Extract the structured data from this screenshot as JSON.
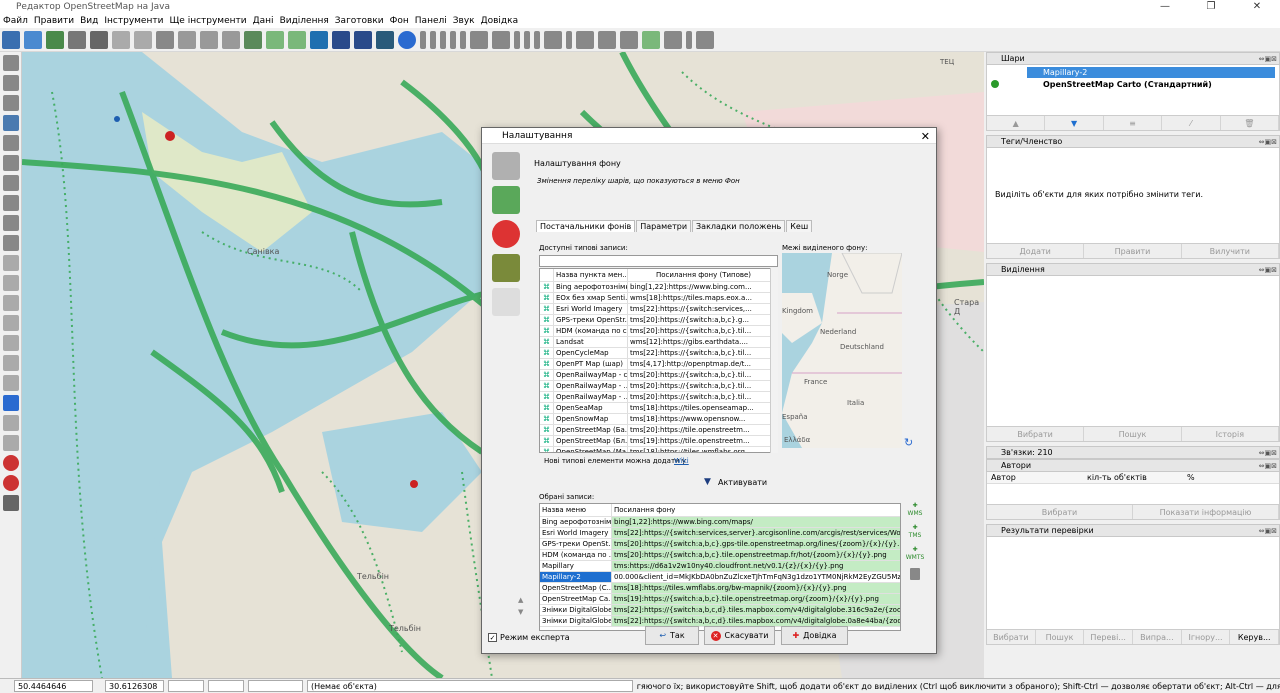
{
  "window": {
    "title": "Редактор OpenStreetMap на Java",
    "controls": [
      "—",
      "❐",
      "✕"
    ]
  },
  "menu": [
    "Файл",
    "Правити",
    "Вид",
    "Інструменти",
    "Ще інструменти",
    "Дані",
    "Виділення",
    "Заготовки",
    "Фон",
    "Панелі",
    "Звук",
    "Довідка"
  ],
  "dialog": {
    "title": "Налаштування",
    "header": "Налаштування фону",
    "subheader": "Змінення переліку шарів, що показуються в меню Фон",
    "tabs": [
      "Постачальники фонів",
      "Параметри",
      "Закладки положень",
      "Кеш"
    ],
    "available_label": "Доступні типові записи:",
    "bounds_label": "Межі виділеного фону:",
    "available_columns": [
      "Назва пункта мен...",
      "Посилання фону (Типове)"
    ],
    "available_rows": [
      {
        "name": "Bing аерофотознімки",
        "url": "bing[1,22]:https://www.bing.com..."
      },
      {
        "name": "EOx без хмар Senti...",
        "url": "wms[18]:https://tiles.maps.eox.a..."
      },
      {
        "name": "Esri World Imagery",
        "url": "tms[22]:https://{switch:services,..."
      },
      {
        "name": "GPS-треки OpenStr...",
        "url": "tms[20]:https://{switch:a,b,c}.g..."
      },
      {
        "name": "HDM (команда по с...",
        "url": "tms[20]:https://{switch:a,b,c}.til..."
      },
      {
        "name": "Landsat",
        "url": "wms[12]:https://gibs.earthdata...."
      },
      {
        "name": "OpenCycleMap",
        "url": "tms[22]:https://{switch:a,b,c}.til..."
      },
      {
        "name": "OpenPT Map (шар)",
        "url": "tms[4,17]:http://openptmap.de/t..."
      },
      {
        "name": "OpenRailwayMap - с...",
        "url": "tms[20]:https://{switch:a,b,c}.til..."
      },
      {
        "name": "OpenRailwayMap - ...",
        "url": "tms[20]:https://{switch:a,b,c}.til..."
      },
      {
        "name": "OpenRailwayMap - ...",
        "url": "tms[20]:https://{switch:a,b,c}.til..."
      },
      {
        "name": "OpenSeaMap",
        "url": "tms[18]:https://tiles.openseamap..."
      },
      {
        "name": "OpenSnowMap",
        "url": "tms[18]:https://www.opensnow..."
      },
      {
        "name": "OpenStreetMap (Ба...",
        "url": "tms[20]:https://tile.openstreetm..."
      },
      {
        "name": "OpenStreetMap (Бл...",
        "url": "tms[19]:https://tile.openstreetm..."
      },
      {
        "name": "OpenStreetMap (Ma...",
        "url": "tms[18]:https://tiles.wmflabs.org..."
      }
    ],
    "map_labels": [
      "Norge",
      "Kingdom",
      "Nederland",
      "Deutschland",
      "France",
      "Italia",
      "España",
      "Ελλάδα"
    ],
    "hint_text": "Нові типові елементи можна додати у",
    "hint_link": "Wiki",
    "activate_label": "Активувати",
    "selected_label": "Обрані записи:",
    "selected_columns": [
      "Назва меню",
      "Посилання фону"
    ],
    "selected_rows": [
      {
        "name": "Bing аерофотознімки",
        "url": "bing[1,22]:https://www.bing.com/maps/"
      },
      {
        "name": "Esri World Imagery",
        "url": "tms[22]:https://{switch:services,server}.arcgisonline.com/arcgis/rest/services/Wo..."
      },
      {
        "name": "GPS-треки OpenSt...",
        "url": "tms[20]:https://{switch:a,b,c}.gps-tile.openstreetmap.org/lines/{zoom}/{x}/{y}.png"
      },
      {
        "name": "HDM (команда по ...",
        "url": "tms[20]:https://{switch:a,b,c}.tile.openstreetmap.fr/hot/{zoom}/{x}/{y}.png"
      },
      {
        "name": "Mapillary",
        "url": "tms:https://d6a1v2w10ny40.cloudfront.net/v0.1/{z}/{x}/{y}.png"
      },
      {
        "name": "Mapillary-2",
        "url": "00.000&client_id=MkJKbDA0bnZuZlcxeTJhTmFqN3g1dzo1YTM0NjRkM2EyZGU5MzBh"
      },
      {
        "name": "OpenStreetMap (C...",
        "url": "tms[18]:https://tiles.wmflabs.org/bw-mapnik/{zoom}/{x}/{y}.png"
      },
      {
        "name": "OpenStreetMap Ca...",
        "url": "tms[19]:https://{switch:a,b,c}.tile.openstreetmap.org/{zoom}/{x}/{y}.png"
      },
      {
        "name": "Знімки DigitalGlobe ...",
        "url": "tms[22]:https://{switch:a,b,c,d}.tiles.mapbox.com/v4/digitalglobe.316c9a2e/{zoo..."
      },
      {
        "name": "Знімки DigitalGlobe ...",
        "url": "tms[22]:https://{switch:a,b,c,d}.tiles.mapbox.com/v4/digitalglobe.0a8e44ba/{zoo..."
      }
    ],
    "side_buttons": [
      "WMS",
      "TMS",
      "WMTS"
    ],
    "expert_mode": "Режим експерта",
    "ok": "Так",
    "cancel": "Скасувати",
    "help": "Довідка"
  },
  "panels": {
    "layers": {
      "title": "Шари",
      "items": [
        "Mapillary-2",
        "OpenStreetMap Carto (Стандартний)"
      ]
    },
    "tags": {
      "title": "Теги/Членство",
      "hint": "Виділіть об'єкти для яких потрібно змінити теги.",
      "buttons": [
        "Додати",
        "Правити",
        "Вилучити"
      ]
    },
    "selection": {
      "title": "Виділення",
      "buttons": [
        "Вибрати",
        "Пошук",
        "Історія"
      ]
    },
    "relations": {
      "title": "Зв'язки: 210"
    },
    "authors": {
      "title": "Автори",
      "columns": [
        "Автор",
        "кіл-ть об'єктів",
        "%"
      ],
      "buttons": [
        "Вибрати",
        "Показати інформацію"
      ]
    },
    "validation": {
      "title": "Результати перевірки"
    },
    "bottom_tabs": [
      "Вибрати",
      "Пошук",
      "Переві...",
      "Випра...",
      "Ігнору...",
      "Керув..."
    ]
  },
  "map_labels": [
    "Санівка",
    "Тельбін",
    "Тельбін",
    "Стара Д",
    "ТЕЦ"
  ],
  "status": {
    "lat": "50.4464646",
    "lon": "30.6126308",
    "object": "(Немає об'єкта)",
    "help": "гяючого їх; використовуйте Shift, щоб додати об'єкт до виділених (Ctrl щоб виключити з обраного); Shift-Ctrl — дозволяє обертати об'єкт; Alt-Ctrl — для масштабування; або виділіть пов"
  }
}
